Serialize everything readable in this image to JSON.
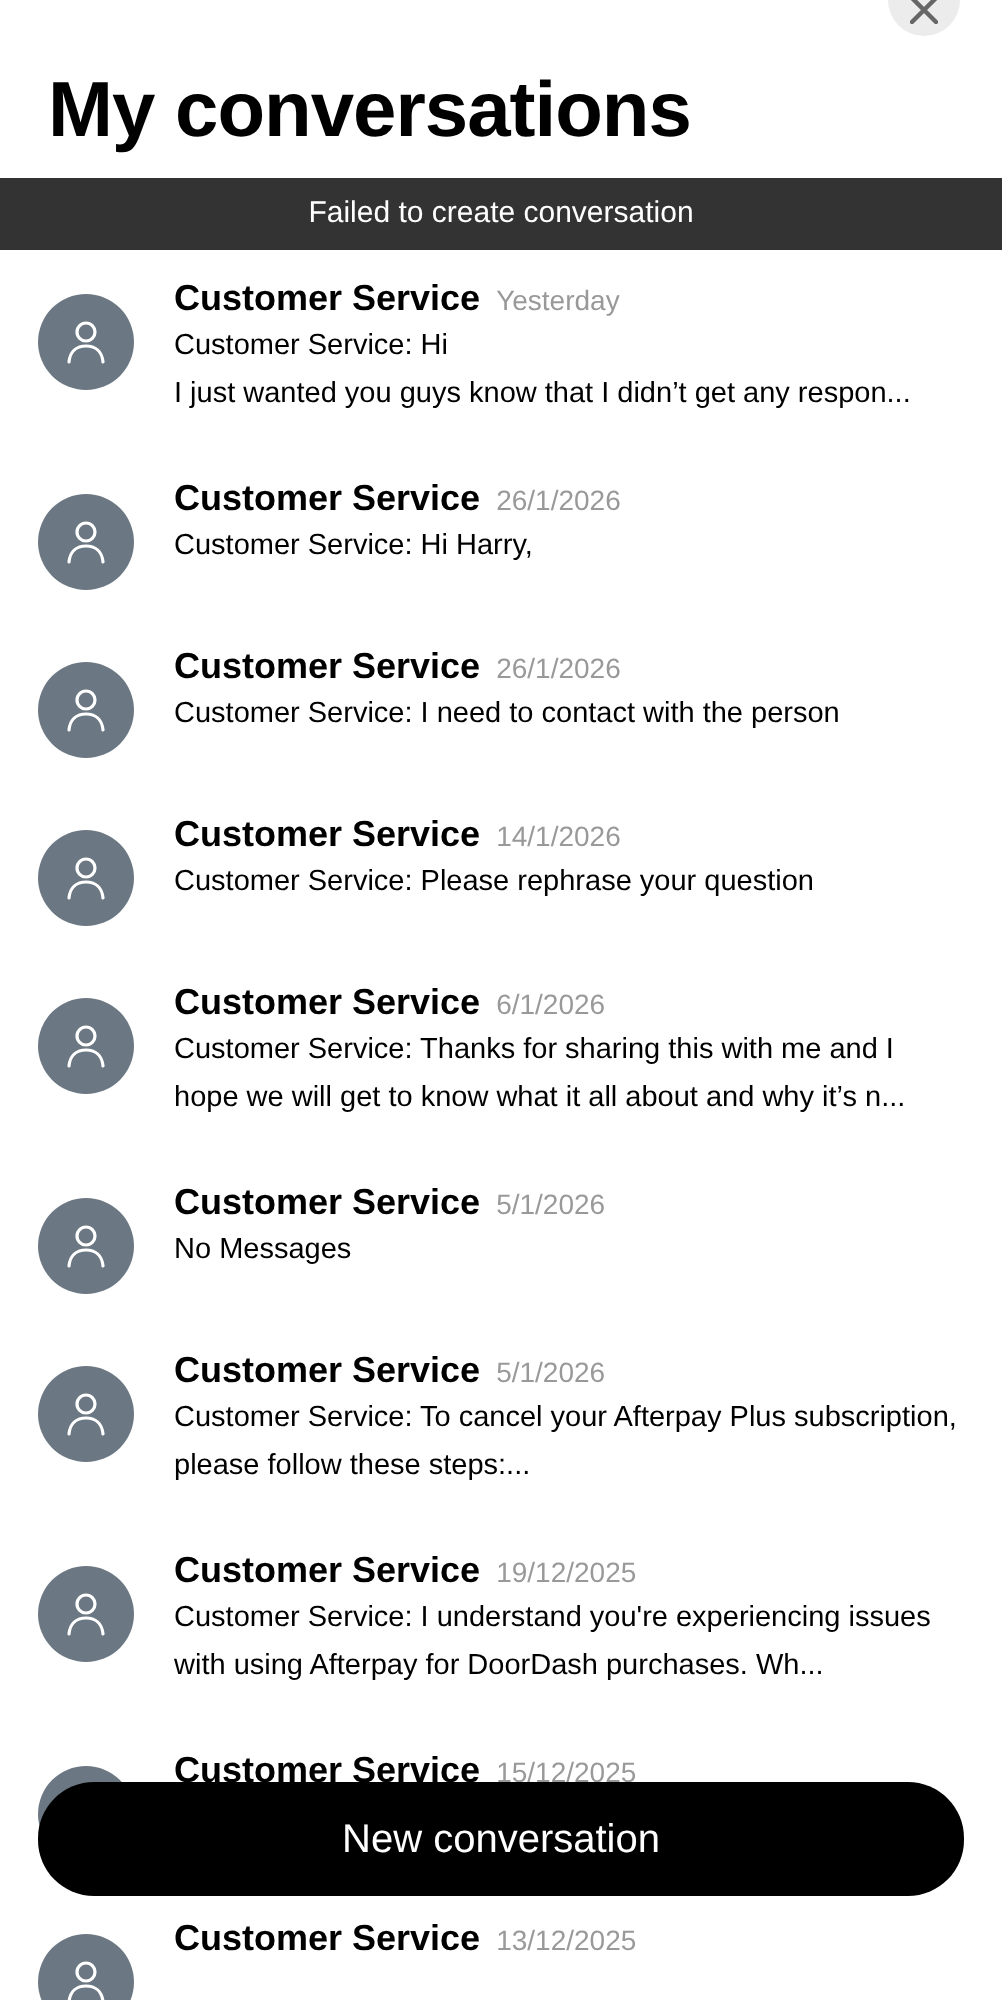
{
  "title": "My conversations",
  "banner": "Failed to create conversation",
  "conversations": [
    {
      "name": "Customer Service",
      "date": "Yesterday",
      "preview": [
        "Customer Service: Hi",
        "I just wanted you guys know that I didn’t get any respon..."
      ]
    },
    {
      "name": "Customer Service",
      "date": "26/1/2026",
      "preview": [
        "Customer Service: Hi Harry,"
      ]
    },
    {
      "name": "Customer Service",
      "date": "26/1/2026",
      "preview": [
        "Customer Service: I need to contact with the person"
      ]
    },
    {
      "name": "Customer Service",
      "date": "14/1/2026",
      "preview": [
        "Customer Service: Please rephrase your question"
      ]
    },
    {
      "name": "Customer Service",
      "date": "6/1/2026",
      "preview": [
        "Customer Service: Thanks for sharing this with me and I hope we will get to know what it all about and why it’s n..."
      ]
    },
    {
      "name": "Customer Service",
      "date": "5/1/2026",
      "preview": [
        "No Messages"
      ]
    },
    {
      "name": "Customer Service",
      "date": "5/1/2026",
      "preview": [
        "Customer Service: To cancel your Afterpay Plus subscription, please follow these steps:..."
      ]
    },
    {
      "name": "Customer Service",
      "date": "19/12/2025",
      "preview": [
        "Customer Service: I understand you're experiencing issues with using Afterpay for DoorDash purchases. Wh..."
      ]
    },
    {
      "name": "Customer Service",
      "date": "15/12/2025"
    },
    {
      "name": "Customer Service",
      "date": "13/12/2025"
    }
  ],
  "new_button": "New conversation"
}
